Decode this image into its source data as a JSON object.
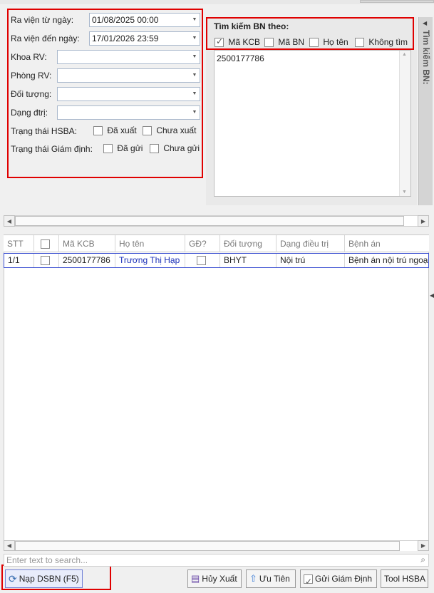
{
  "filters": {
    "from_date_label": "Ra viện từ ngày:",
    "from_date_value": "01/08/2025 00:00",
    "to_date_label": "Ra viện đến ngày:",
    "to_date_value": "17/01/2026 23:59",
    "khoa_label": "Khoa RV:",
    "phong_label": "Phòng RV:",
    "doituong_label": "Đối tượng:",
    "dangdtri_label": "Dạng đtrị:",
    "hsba_label": "Trạng thái HSBA:",
    "hsba_opt1": "Đã xuất",
    "hsba_opt2": "Chưa xuất",
    "giamdinh_label": "Trạng thái Giám định:",
    "giamdinh_opt1": "Đã gửi",
    "giamdinh_opt2": "Chưa gửi"
  },
  "search": {
    "title": "Tìm kiếm BN theo:",
    "opt_makcb": "Mã KCB",
    "opt_mabn": "Mã BN",
    "opt_hoten": "Họ tên",
    "opt_khongtim": "Không tìm",
    "text_value": "2500177786",
    "side_tab_label": "Tìm kiếm BN:"
  },
  "grid": {
    "headers": [
      "STT",
      "",
      "Mã KCB",
      "Họ tên",
      "GĐ?",
      "Đối tượng",
      "Dạng điều trị",
      "Bệnh án"
    ],
    "rows": [
      {
        "stt": "1/1",
        "makcb": "2500177786",
        "hoten": "Trương Thị Hạp",
        "doituong": "BHYT",
        "dangdieutri": "Nội trú",
        "benhan": "Bệnh án nội trú ngoại"
      }
    ],
    "search_placeholder": "Enter text to search..."
  },
  "toolbar": {
    "nap_dsbn": "Nạp DSBN (F5)",
    "huy_xuat": "Hủy Xuất",
    "uu_tien": "Ưu Tiên",
    "gui_giam_dinh": "Gửi Giám Định",
    "tool_hsba": "Tool HSBA"
  },
  "colors": {
    "highlight_red": "#e00000",
    "row_border": "#3b4fd1",
    "name_text": "#1a2fb8"
  }
}
